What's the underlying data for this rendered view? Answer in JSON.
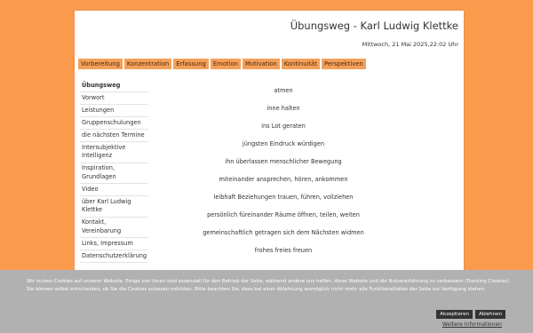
{
  "header": {
    "title": "Übungsweg - Karl Ludwig Klettke",
    "datetime": "Mittwoch, 21 Mai 2025,22:02 Uhr"
  },
  "nav": {
    "tabs": [
      "Vorbereitung",
      "Konzentration",
      "Erfassung",
      "Emotion",
      "Motivation",
      "Kontinuität",
      "Perspektiven"
    ]
  },
  "sidebar": {
    "items": [
      "Übungsweg",
      "Vorwort",
      "Leistungen",
      "Gruppenschulungen",
      "die nächsten Termine",
      "Intersubjektive Intelligenz",
      "Inspiration, Grundlagen",
      "Video",
      "über Karl Ludwig Klettke",
      "Kontakt, Vereinbarung",
      "Links, Impressum",
      "Datenschutzerklärung"
    ],
    "active_index": 0
  },
  "content": {
    "lines": [
      "atmen",
      "inne halten",
      "ins Lot geraten",
      "jüngsten Eindruck würdigen",
      "ihn überlassen menschlicher Bewegung",
      "miteinander ansprechen, hören, ankommen",
      "leibhaft Beziehungen trauen, führen, vollziehen",
      "persönlich füreinander Räume öffnen, teilen, weiten",
      "gemeinschaftlich getragen sich dem Nächsten widmen",
      "frohes freies freuen"
    ]
  },
  "cookie": {
    "text": "Wir nutzen Cookies auf unserer Website. Einige von ihnen sind essenziell für den Betrieb der Seite, während andere uns helfen, diese Website und die Nutzererfahrung zu verbessern (Tracking Cookies). Sie können selbst entscheiden, ob Sie die Cookies zulassen möchten. Bitte beachten Sie, dass bei einer Ablehnung womöglich nicht mehr alle Funktionalitäten der Seite zur Verfügung stehen.",
    "accept_label": "Akzeptieren",
    "decline_label": "Ablehnen",
    "more_info_label": "Weitere Informationen"
  },
  "colors": {
    "background": "#fb9b4e",
    "tab": "#f5a05a",
    "cookie_banner": "#b1b1b1",
    "cookie_button": "#333333"
  }
}
